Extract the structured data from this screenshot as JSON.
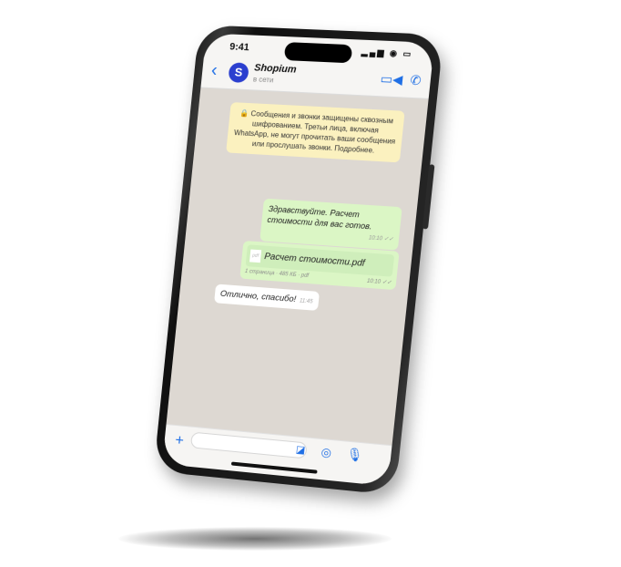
{
  "status_bar": {
    "time": "9:41",
    "icons": "▂▄▆ ◉ ▭"
  },
  "header": {
    "back_icon": "‹",
    "avatar_letter": "S",
    "contact_name": "Shopium",
    "contact_status": "в сети",
    "video_icon": "▭◀",
    "call_icon": "✆"
  },
  "encryption_notice": "🔒 Сообщения и звонки защищены сквозным шифрованием. Третьи лица, включая WhatsApp, не могут прочитать ваши сообщения или прослушать звонки. Подробнее.",
  "messages": [
    {
      "text": "Здравствуйте. Расчет стоимости для вас готов.",
      "time": "10:10 ✓✓"
    },
    {
      "file_name": "Расчет стоимости.pdf",
      "file_icon": "pdf",
      "file_meta": "1 страница · 485 КБ · pdf",
      "time": "10:10 ✓✓"
    },
    {
      "text": "Отлично, спасибо!",
      "time": "11:45"
    }
  ],
  "input_bar": {
    "attach_icon": "+",
    "placeholder": "",
    "sticker_icon": "◪",
    "camera_icon": "◎",
    "mic_icon": "🎙"
  },
  "colors": {
    "accent": "#1f6fe5",
    "outgoing_bubble": "#dbf6c5",
    "notice": "#fbf1bf",
    "chat_background": "#ddd8d2"
  }
}
